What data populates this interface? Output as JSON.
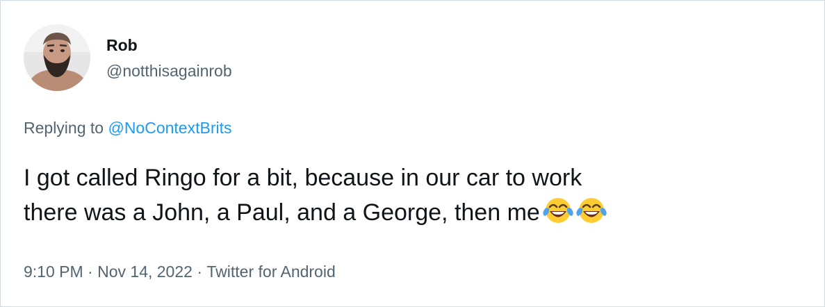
{
  "user": {
    "display_name": "Rob",
    "handle": "@notthisagainrob",
    "avatar_icon": "profile-photo-bearded-man"
  },
  "reply": {
    "prefix": "Replying to",
    "mention": "@NoContextBrits"
  },
  "tweet": {
    "line1": "I got called Ringo for a bit, because in our car to work",
    "line2": "there was a John, a Paul, and a George, then me",
    "emoji": [
      "face-with-tears-of-joy",
      "face-with-tears-of-joy"
    ]
  },
  "meta": {
    "time": "9:10 PM",
    "separator": "·",
    "date": "Nov 14, 2022",
    "source": "Twitter for Android"
  },
  "colors": {
    "text_primary": "#0f1419",
    "text_secondary": "#536471",
    "link": "#1d9bf0",
    "border": "#cfd9de"
  }
}
